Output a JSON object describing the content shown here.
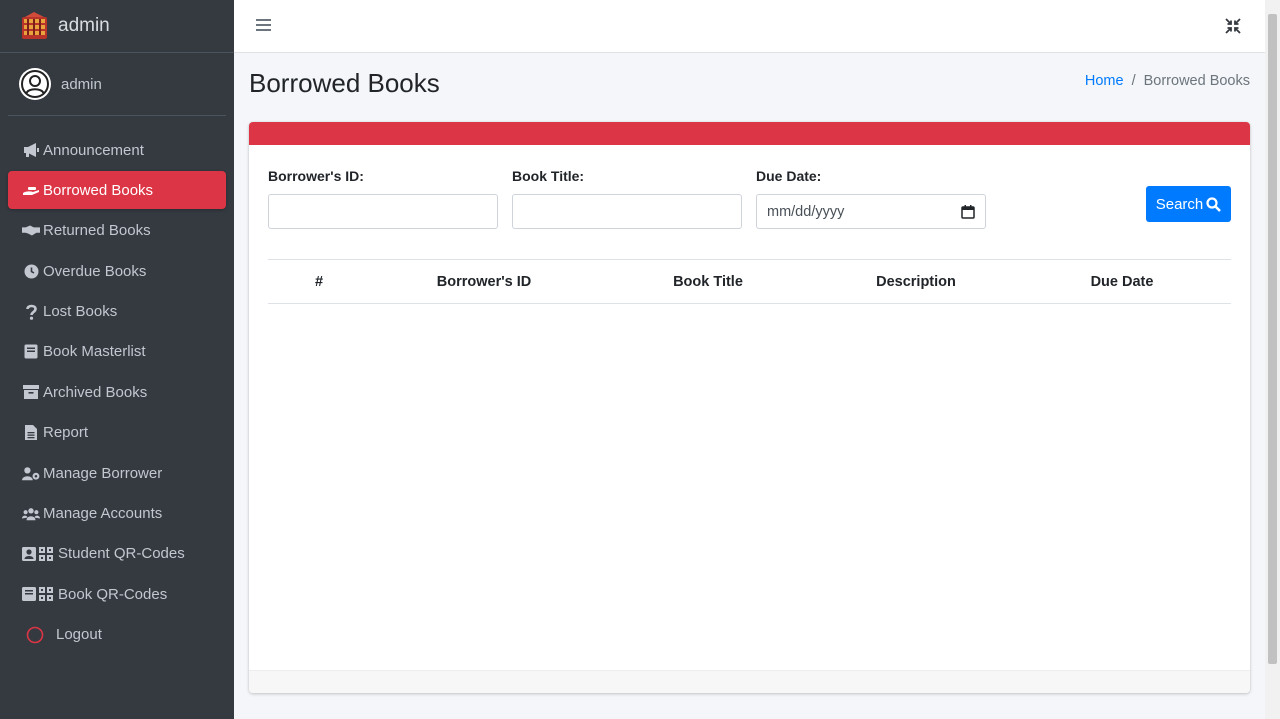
{
  "brand": {
    "title": "admin"
  },
  "user": {
    "name": "admin"
  },
  "sidebar": {
    "items": [
      {
        "label": "Announcement",
        "icon": "bullhorn-icon"
      },
      {
        "label": "Borrowed Books",
        "icon": "hand-book-icon"
      },
      {
        "label": "Returned Books",
        "icon": "handshake-icon"
      },
      {
        "label": "Overdue Books",
        "icon": "clock-icon"
      },
      {
        "label": "Lost Books",
        "icon": "question-icon"
      },
      {
        "label": "Book Masterlist",
        "icon": "book-icon"
      },
      {
        "label": "Archived Books",
        "icon": "archive-icon"
      },
      {
        "label": "Report",
        "icon": "file-icon"
      },
      {
        "label": "Manage Borrower",
        "icon": "user-cog-icon"
      },
      {
        "label": "Manage Accounts",
        "icon": "users-icon"
      },
      {
        "label": "Student QR-Codes",
        "icon": "student-qr-icon"
      },
      {
        "label": "Book QR-Codes",
        "icon": "book-qr-icon"
      },
      {
        "label": "Logout",
        "icon": "power-icon"
      }
    ],
    "active_index": 1
  },
  "page": {
    "title": "Borrowed Books",
    "breadcrumb": {
      "home": "Home",
      "separator": "/",
      "current": "Borrowed Books"
    }
  },
  "filters": {
    "borrower_id_label": "Borrower's ID:",
    "borrower_id_value": "",
    "book_title_label": "Book Title:",
    "book_title_value": "",
    "due_date_label": "Due Date:",
    "due_date_placeholder": "mm/dd/yyyy",
    "search_label": "Search"
  },
  "table": {
    "columns": [
      "#",
      "Borrower's ID",
      "Book Title",
      "Description",
      "Due Date"
    ],
    "rows": []
  },
  "colors": {
    "sidebar_bg": "#343a40",
    "accent_red": "#dc3545",
    "primary_blue": "#007bff"
  }
}
